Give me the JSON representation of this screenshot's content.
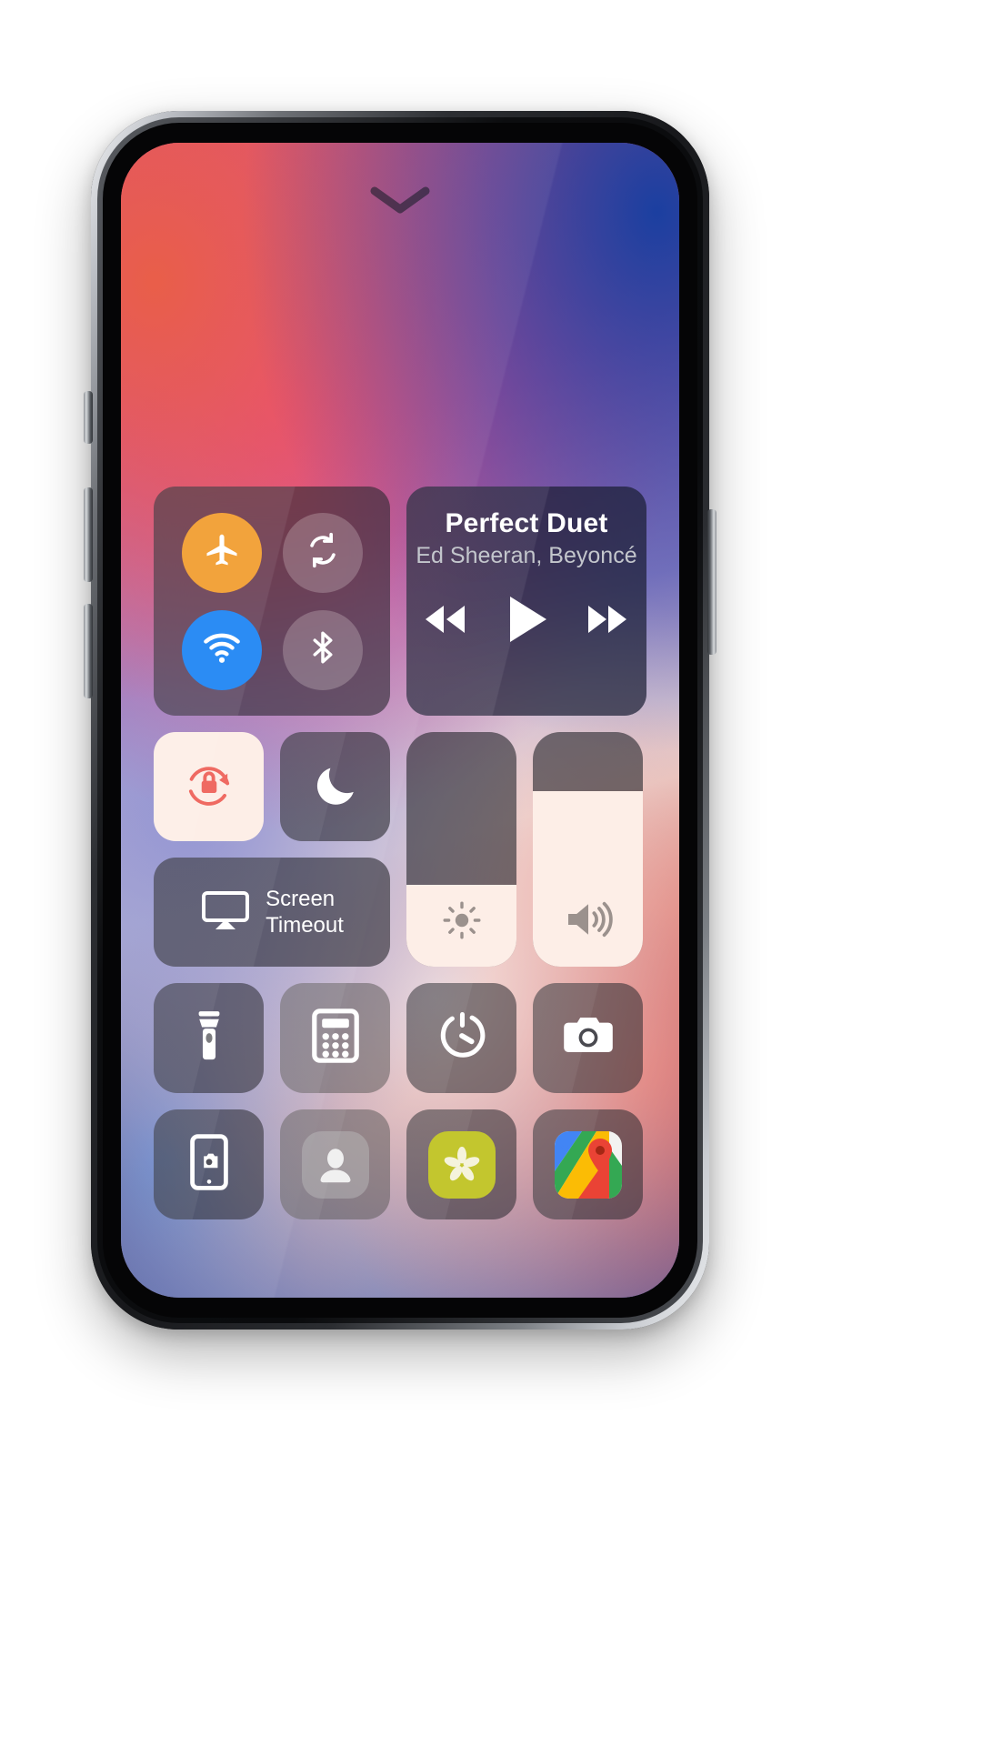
{
  "device": {
    "name": "smartphone-mockup"
  },
  "screen": {
    "handle_icon": "chevron-down-icon",
    "wallpaper": "ios-x-gradient-wallpaper"
  },
  "control_center": {
    "connectivity": {
      "name": "connectivity-tile",
      "toggles": [
        {
          "id": "airplane",
          "icon": "airplane-icon",
          "label": "Airplane Mode",
          "state": "on",
          "color": "#f2a33c"
        },
        {
          "id": "sync",
          "icon": "sync-rotate-icon",
          "label": "Mobile Data",
          "state": "off",
          "color": "#eae1e1"
        },
        {
          "id": "wifi",
          "icon": "wifi-icon",
          "label": "Wi-Fi",
          "state": "on",
          "color": "#2b8cf4"
        },
        {
          "id": "bluetooth",
          "icon": "bluetooth-icon",
          "label": "Bluetooth",
          "state": "off",
          "color": "#eae1e1"
        }
      ]
    },
    "music": {
      "name": "now-playing-card",
      "title": "Perfect Duet",
      "artist": "Ed Sheeran, Beyoncé",
      "controls": [
        {
          "id": "rewind",
          "icon": "rewind-icon",
          "label": "Rewind"
        },
        {
          "id": "play",
          "icon": "play-icon",
          "label": "Play"
        },
        {
          "id": "fast-forward",
          "icon": "fast-forward-icon",
          "label": "Fast Forward"
        }
      ]
    },
    "toggles": [
      {
        "id": "rotation-lock",
        "icon": "rotation-lock-icon",
        "label": "Rotation Lock",
        "state": "on",
        "accent": "#ef6a62"
      },
      {
        "id": "do-not-disturb",
        "icon": "moon-icon",
        "label": "Do Not Disturb",
        "state": "off",
        "accent": "#ffffff"
      }
    ],
    "screen_timeout": {
      "name": "screen-timeout-button",
      "icon": "airplay-screen-icon",
      "label": "Screen\nTimeout"
    },
    "sliders": [
      {
        "id": "brightness",
        "icon": "brightness-icon",
        "label": "Brightness",
        "value": 35,
        "unit": "%"
      },
      {
        "id": "volume",
        "icon": "volume-icon",
        "label": "Volume",
        "value": 75,
        "unit": "%"
      }
    ],
    "shortcuts_row_1": [
      {
        "id": "flashlight",
        "icon": "flashlight-icon",
        "label": "Flashlight"
      },
      {
        "id": "calculator",
        "icon": "calculator-icon",
        "label": "Calculator"
      },
      {
        "id": "timer",
        "icon": "timer-icon",
        "label": "Timer"
      },
      {
        "id": "camera",
        "icon": "camera-icon",
        "label": "Camera"
      }
    ],
    "shortcuts_row_2": [
      {
        "id": "screen-record",
        "icon": "screen-record-icon",
        "label": "Screen Record"
      },
      {
        "id": "contacts",
        "icon": "contact-person-icon",
        "label": "Contacts"
      },
      {
        "id": "wellness",
        "icon": "flower-icon",
        "label": "Wellness"
      },
      {
        "id": "google-maps",
        "icon": "google-maps-icon",
        "label": "Maps"
      }
    ]
  },
  "colors": {
    "accent_blue": "#2b8cf4",
    "accent_amber": "#f2a33c",
    "accent_red": "#ef6a62",
    "slider_fill": "#fdeee7",
    "tile_bg": "rgba(40,40,46,0.60)"
  }
}
